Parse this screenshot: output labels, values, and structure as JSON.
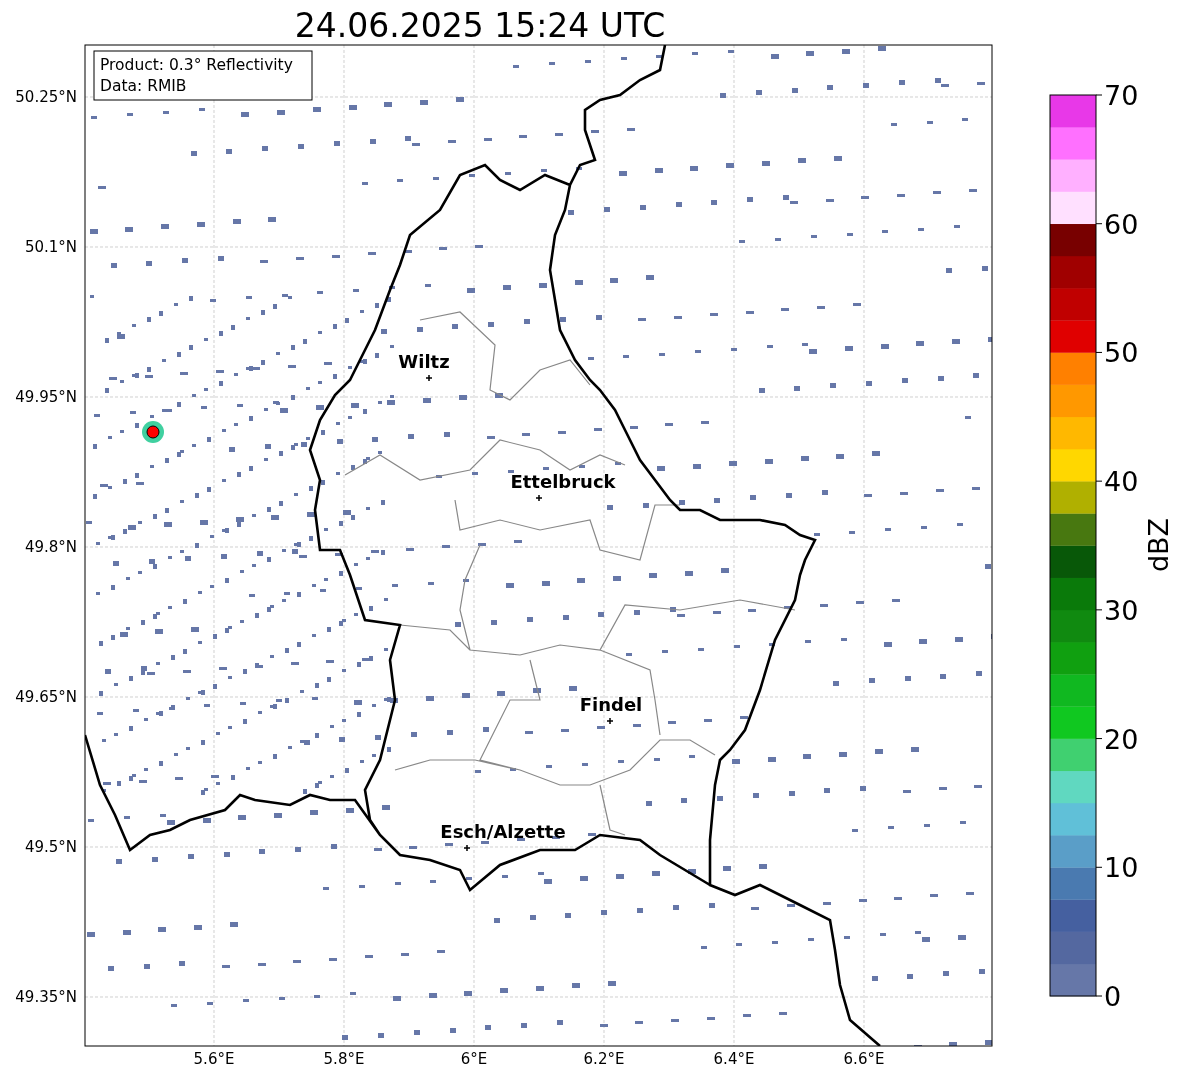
{
  "title": "24.06.2025 15:24 UTC",
  "legend": [
    "Product: 0.3° Reflectivity",
    "Data: RMIB"
  ],
  "cities": [
    {
      "name": "Wiltz"
    },
    {
      "name": "Ettelbruck"
    },
    {
      "name": "Findel"
    },
    {
      "name": "Esch/Alzette"
    }
  ],
  "y_ticks": [
    "50.25°N",
    "50.1°N",
    "49.95°N",
    "49.8°N",
    "49.65°N",
    "49.5°N",
    "49.35°N"
  ],
  "x_ticks": [
    "5.6°E",
    "5.8°E",
    "6°E",
    "6.2°E",
    "6.4°E",
    "6.6°E"
  ],
  "colorbar": {
    "label": "dBZ",
    "ticks": [
      "70",
      "60",
      "50",
      "40",
      "30",
      "20",
      "10",
      "0"
    ],
    "bins": [
      {
        "color": "#6677a8"
      },
      {
        "color": "#5468a0"
      },
      {
        "color": "#4560a0"
      },
      {
        "color": "#4a7ab0"
      },
      {
        "color": "#5a9ec8"
      },
      {
        "color": "#60c0d8"
      },
      {
        "color": "#60d8c0"
      },
      {
        "color": "#40d070"
      },
      {
        "color": "#10c820"
      },
      {
        "color": "#10b820"
      },
      {
        "color": "#10a010"
      },
      {
        "color": "#108a10"
      },
      {
        "color": "#0a7a0a"
      },
      {
        "color": "#085808"
      },
      {
        "color": "#487810"
      },
      {
        "color": "#b0b000"
      },
      {
        "color": "#ffd700"
      },
      {
        "color": "#ffb800"
      },
      {
        "color": "#ff9800"
      },
      {
        "color": "#ff8000"
      },
      {
        "color": "#e00000"
      },
      {
        "color": "#c00000"
      },
      {
        "color": "#a00000"
      },
      {
        "color": "#780000"
      },
      {
        "color": "#ffe0ff"
      },
      {
        "color": "#ffb0ff"
      },
      {
        "color": "#ff70ff"
      },
      {
        "color": "#e838e8"
      }
    ]
  }
}
